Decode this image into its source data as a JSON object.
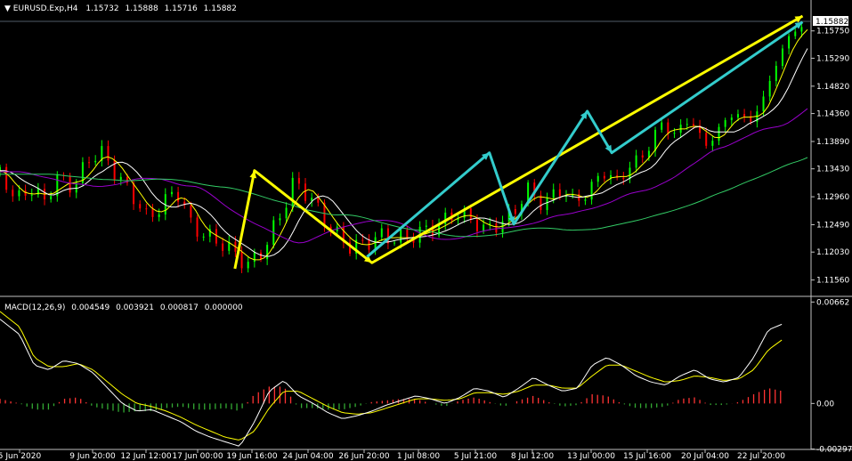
{
  "window": {
    "symbol": "EURUSD.Exp,H4",
    "open": "1.15732",
    "high": "1.15888",
    "low": "1.15716",
    "close": "1.15882",
    "current_price_label": "1.15882"
  },
  "indicator": {
    "label": "MACD(12,26,9)",
    "main": "0.004549",
    "signal": "0.003921",
    "hist": "0.000817",
    "extra": "0.000000"
  },
  "colors": {
    "background": "#000000",
    "grid_line": "#c0c0c0",
    "bull_candle": "#00ff00",
    "bear_candle": "#ff0000",
    "ma_fast": "#ffff00",
    "ma_white": "#ffffff",
    "ma_mid": "#9900cc",
    "ma_slow": "#33cc66",
    "macd_main": "#ffffff",
    "macd_signal": "#ffff00",
    "hist_pos": "#ff3333",
    "hist_neg": "#33aa33",
    "arrow_yellow": "#ffff00",
    "arrow_cyan": "#33cccc"
  },
  "chart_data": [
    {
      "type": "line",
      "subtype": "candlestick",
      "title": "EURUSD.Exp,H4",
      "y_ticks": [
        "1.15750",
        "1.15290",
        "1.14820",
        "1.14360",
        "1.13890",
        "1.13430",
        "1.12960",
        "1.12490",
        "1.12030",
        "1.11560"
      ],
      "ylim": [
        1.113,
        1.16
      ],
      "x_ticks": [
        "5 Jun 2020",
        "9 Jun 20:00",
        "12 Jun 12:00",
        "17 Jun 00:00",
        "19 Jun 16:00",
        "24 Jun 04:00",
        "26 Jun 20:00",
        "1 Jul 08:00",
        "5 Jul 21:00",
        "8 Jul 12:00",
        "13 Jul 00:00",
        "15 Jul 16:00",
        "20 Jul 04:00",
        "22 Jul 20:00"
      ],
      "price_path": [
        [
          0,
          1.134
        ],
        [
          6,
          1.129
        ],
        [
          12,
          1.131
        ],
        [
          18,
          1.129
        ],
        [
          24,
          1.133
        ],
        [
          30,
          1.131
        ],
        [
          36,
          1.136
        ],
        [
          42,
          1.137
        ],
        [
          48,
          1.133
        ],
        [
          54,
          1.13
        ],
        [
          60,
          1.126
        ],
        [
          66,
          1.128
        ],
        [
          72,
          1.131
        ],
        [
          78,
          1.125
        ],
        [
          84,
          1.123
        ],
        [
          90,
          1.122
        ],
        [
          96,
          1.12
        ],
        [
          102,
          1.118
        ],
        [
          108,
          1.121
        ],
        [
          114,
          1.126
        ],
        [
          120,
          1.132
        ],
        [
          126,
          1.13
        ],
        [
          132,
          1.126
        ],
        [
          138,
          1.123
        ],
        [
          144,
          1.121
        ],
        [
          150,
          1.122
        ],
        [
          156,
          1.123
        ],
        [
          162,
          1.1225
        ],
        [
          168,
          1.123
        ],
        [
          174,
          1.124
        ],
        [
          180,
          1.125
        ],
        [
          186,
          1.127
        ],
        [
          192,
          1.126
        ],
        [
          198,
          1.124
        ],
        [
          204,
          1.125
        ],
        [
          210,
          1.127
        ],
        [
          216,
          1.131
        ],
        [
          222,
          1.128
        ],
        [
          228,
          1.131
        ],
        [
          234,
          1.129
        ],
        [
          240,
          1.13
        ],
        [
          246,
          1.134
        ],
        [
          252,
          1.132
        ],
        [
          258,
          1.135
        ],
        [
          264,
          1.137
        ],
        [
          270,
          1.142
        ],
        [
          276,
          1.14
        ],
        [
          282,
          1.143
        ],
        [
          288,
          1.138
        ],
        [
          294,
          1.141
        ],
        [
          300,
          1.144
        ],
        [
          306,
          1.142
        ],
        [
          312,
          1.146
        ],
        [
          318,
          1.153
        ],
        [
          324,
          1.1575
        ],
        [
          330,
          1.1588
        ]
      ],
      "series": [
        {
          "name": "MA fast (yellow)",
          "role": "ma_fast"
        },
        {
          "name": "MA white",
          "role": "ma_white"
        },
        {
          "name": "MA purple",
          "role": "ma_mid"
        },
        {
          "name": "MA green",
          "role": "ma_slow"
        }
      ],
      "annotations": [
        {
          "type": "yellow-arrow",
          "points": [
            [
              1.1175,
              96
            ],
            [
              1.134,
              104
            ],
            [
              1.1185,
              152
            ],
            [
              1.16,
              328
            ]
          ]
        },
        {
          "type": "cyan-zigzag",
          "points": [
            [
              1.1195,
              150
            ],
            [
              1.137,
              200
            ],
            [
              1.125,
              210
            ],
            [
              1.144,
              240
            ],
            [
              1.137,
              250
            ],
            [
              1.159,
              328
            ]
          ]
        }
      ]
    },
    {
      "type": "line",
      "subtype": "macd",
      "title": "MACD(12,26,9)",
      "y_ticks": [
        "0.00662",
        "0.00",
        "-0.00297"
      ],
      "ylim": [
        -0.003,
        0.0067
      ],
      "main_path": [
        [
          0,
          0.0055
        ],
        [
          8,
          0.0045
        ],
        [
          14,
          0.0025
        ],
        [
          20,
          0.0022
        ],
        [
          26,
          0.0028
        ],
        [
          32,
          0.0026
        ],
        [
          38,
          0.002
        ],
        [
          44,
          0.001
        ],
        [
          50,
          0.0
        ],
        [
          56,
          -0.0005
        ],
        [
          62,
          -0.0004
        ],
        [
          68,
          -0.0008
        ],
        [
          74,
          -0.0012
        ],
        [
          80,
          -0.0018
        ],
        [
          86,
          -0.0022
        ],
        [
          92,
          -0.0025
        ],
        [
          98,
          -0.0028
        ],
        [
          104,
          -0.0012
        ],
        [
          110,
          0.0008
        ],
        [
          116,
          0.0015
        ],
        [
          122,
          0.0005
        ],
        [
          128,
          0.0
        ],
        [
          134,
          -0.0006
        ],
        [
          140,
          -0.001
        ],
        [
          146,
          -0.0008
        ],
        [
          152,
          -0.0005
        ],
        [
          158,
          -0.0001
        ],
        [
          164,
          0.0002
        ],
        [
          170,
          0.0005
        ],
        [
          176,
          0.0003
        ],
        [
          182,
          0.0
        ],
        [
          188,
          0.0004
        ],
        [
          194,
          0.001
        ],
        [
          200,
          0.0008
        ],
        [
          206,
          0.0004
        ],
        [
          212,
          0.001
        ],
        [
          218,
          0.0017
        ],
        [
          224,
          0.0012
        ],
        [
          230,
          0.0008
        ],
        [
          236,
          0.001
        ],
        [
          242,
          0.0025
        ],
        [
          248,
          0.003
        ],
        [
          254,
          0.0025
        ],
        [
          260,
          0.0018
        ],
        [
          266,
          0.0014
        ],
        [
          272,
          0.0012
        ],
        [
          278,
          0.0018
        ],
        [
          284,
          0.0022
        ],
        [
          290,
          0.0016
        ],
        [
          296,
          0.0014
        ],
        [
          302,
          0.0017
        ],
        [
          308,
          0.003
        ],
        [
          314,
          0.0048
        ],
        [
          320,
          0.0052
        ]
      ],
      "signal_path": [
        [
          0,
          0.006
        ],
        [
          8,
          0.005
        ],
        [
          14,
          0.003
        ],
        [
          20,
          0.0024
        ],
        [
          26,
          0.0024
        ],
        [
          32,
          0.0026
        ],
        [
          38,
          0.0022
        ],
        [
          44,
          0.0014
        ],
        [
          50,
          0.0006
        ],
        [
          56,
          0.0
        ],
        [
          62,
          -0.0002
        ],
        [
          68,
          -0.0005
        ],
        [
          74,
          -0.0009
        ],
        [
          80,
          -0.0014
        ],
        [
          86,
          -0.0018
        ],
        [
          92,
          -0.0022
        ],
        [
          98,
          -0.0024
        ],
        [
          104,
          -0.0018
        ],
        [
          110,
          -0.0003
        ],
        [
          116,
          0.0008
        ],
        [
          122,
          0.0008
        ],
        [
          128,
          0.0003
        ],
        [
          134,
          -0.0002
        ],
        [
          140,
          -0.0006
        ],
        [
          146,
          -0.0007
        ],
        [
          152,
          -0.0006
        ],
        [
          158,
          -0.0003
        ],
        [
          164,
          0.0
        ],
        [
          170,
          0.0003
        ],
        [
          176,
          0.0003
        ],
        [
          182,
          0.0002
        ],
        [
          188,
          0.0003
        ],
        [
          194,
          0.0007
        ],
        [
          200,
          0.0007
        ],
        [
          206,
          0.0006
        ],
        [
          212,
          0.0008
        ],
        [
          218,
          0.0012
        ],
        [
          224,
          0.0012
        ],
        [
          230,
          0.001
        ],
        [
          236,
          0.001
        ],
        [
          242,
          0.0018
        ],
        [
          248,
          0.0025
        ],
        [
          254,
          0.0025
        ],
        [
          260,
          0.0021
        ],
        [
          266,
          0.0017
        ],
        [
          272,
          0.0014
        ],
        [
          278,
          0.0015
        ],
        [
          284,
          0.0018
        ],
        [
          290,
          0.0017
        ],
        [
          296,
          0.0015
        ],
        [
          302,
          0.0016
        ],
        [
          308,
          0.0022
        ],
        [
          314,
          0.0035
        ],
        [
          320,
          0.0042
        ]
      ],
      "hist_path": [
        [
          0,
          0.0003
        ],
        [
          8,
          0.0
        ],
        [
          14,
          -0.0004
        ],
        [
          20,
          -0.0004
        ],
        [
          26,
          0.0003
        ],
        [
          32,
          0.0004
        ],
        [
          38,
          -0.0002
        ],
        [
          44,
          -0.0004
        ],
        [
          50,
          -0.0006
        ],
        [
          56,
          -0.0005
        ],
        [
          62,
          -0.0005
        ],
        [
          68,
          -0.0003
        ],
        [
          74,
          -0.0002
        ],
        [
          80,
          -0.0004
        ],
        [
          86,
          -0.0004
        ],
        [
          92,
          -0.0003
        ],
        [
          98,
          -0.0005
        ],
        [
          104,
          0.0006
        ],
        [
          110,
          0.0011
        ],
        [
          116,
          0.0011
        ],
        [
          122,
          -0.0003
        ],
        [
          128,
          -0.0003
        ],
        [
          134,
          -0.0004
        ],
        [
          140,
          -0.0004
        ],
        [
          146,
          -0.0002
        ],
        [
          152,
          0.0001
        ],
        [
          158,
          0.0002
        ],
        [
          164,
          0.0003
        ],
        [
          170,
          0.0003
        ],
        [
          176,
          0.0
        ],
        [
          182,
          -0.0002
        ],
        [
          188,
          0.0002
        ],
        [
          194,
          0.0004
        ],
        [
          200,
          0.0001
        ],
        [
          206,
          -0.0002
        ],
        [
          212,
          0.0002
        ],
        [
          218,
          0.0005
        ],
        [
          224,
          0.0001
        ],
        [
          230,
          -0.0002
        ],
        [
          236,
          -0.0001
        ],
        [
          242,
          0.0006
        ],
        [
          248,
          0.0005
        ],
        [
          254,
          0.0
        ],
        [
          260,
          -0.0003
        ],
        [
          266,
          -0.0003
        ],
        [
          272,
          -0.0002
        ],
        [
          278,
          0.0003
        ],
        [
          284,
          0.0004
        ],
        [
          290,
          -0.0001
        ],
        [
          296,
          -0.0001
        ],
        [
          302,
          0.0001
        ],
        [
          308,
          0.0006
        ],
        [
          314,
          0.001
        ],
        [
          320,
          0.0008
        ]
      ]
    }
  ]
}
